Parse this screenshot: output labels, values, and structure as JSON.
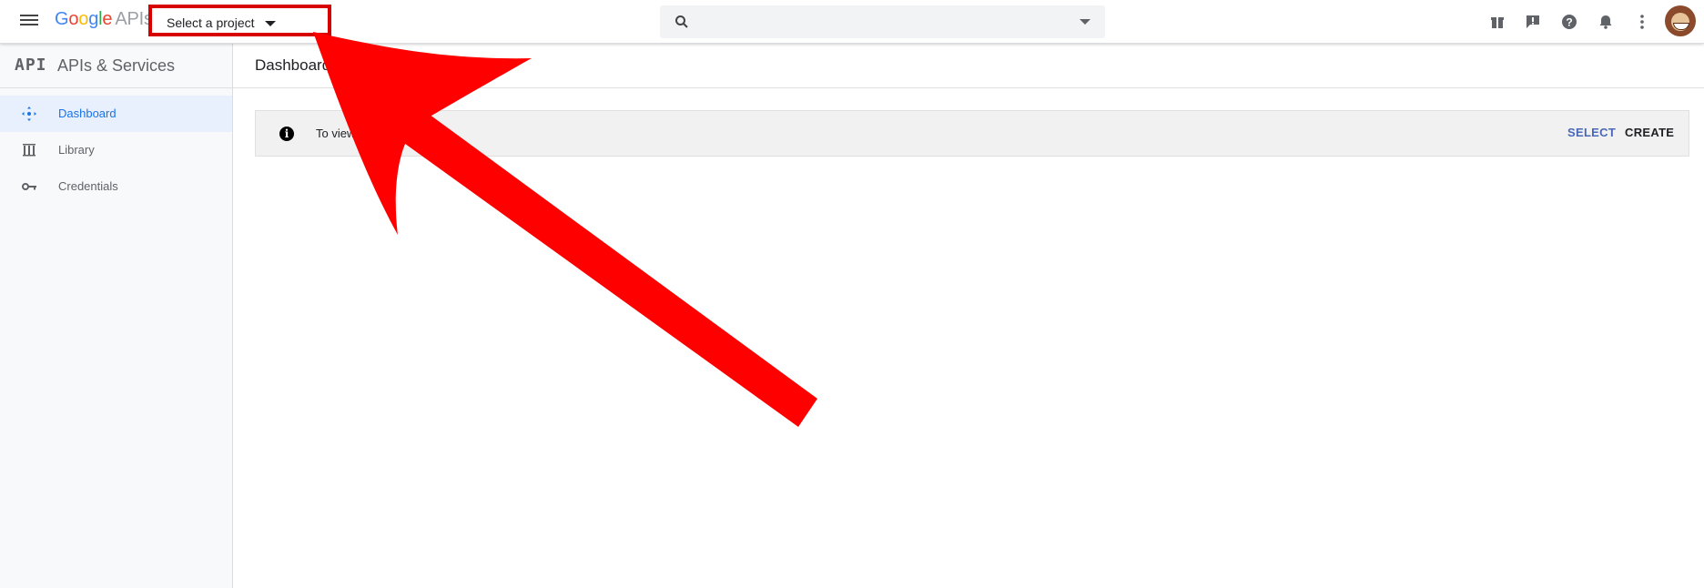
{
  "header": {
    "logo_text": "Google",
    "logo_suffix": "APIs",
    "project_selector": "Select a project",
    "search_placeholder": "",
    "icons": [
      "gift-icon",
      "feedback-icon",
      "help-icon",
      "notifications-icon",
      "more-vert-icon"
    ]
  },
  "sidebar": {
    "logo": "API",
    "title": "APIs & Services",
    "items": [
      {
        "label": "Dashboard",
        "icon": "dashboard-icon",
        "active": true
      },
      {
        "label": "Library",
        "icon": "library-icon",
        "active": false
      },
      {
        "label": "Credentials",
        "icon": "key-icon",
        "active": false
      }
    ]
  },
  "main": {
    "title": "Dashboard",
    "banner": {
      "message": "To view th                   ject.",
      "select_label": "SELECT",
      "create_label": "CREATE"
    }
  },
  "colors": {
    "accent": "#1a73e8",
    "annotation_red": "#ff0000",
    "highlight_border": "#d60000",
    "banner_bg": "#f1f1f1"
  }
}
